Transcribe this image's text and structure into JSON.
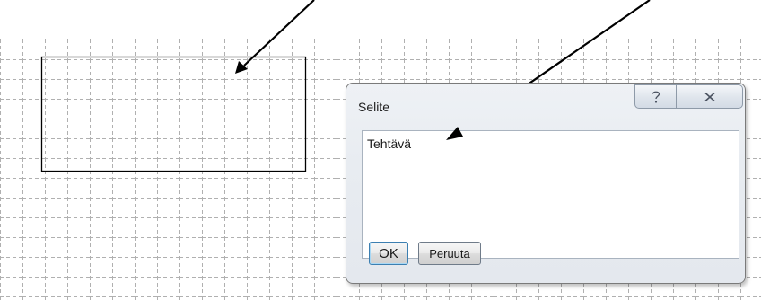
{
  "dialog": {
    "title": "Selite",
    "help_icon": "question-mark-icon",
    "close_icon": "close-x-icon",
    "text_value": "Tehtävä",
    "ok_label": "OK",
    "cancel_label": "Peruuta"
  },
  "canvas": {
    "shape": "rectangle",
    "grid": true
  },
  "annotations": {
    "arrow_count": 2
  },
  "colors": {
    "grid": "#b8b8b8",
    "rect_border": "#000000",
    "dialog_bg": "#e8ecf1",
    "ok_focus": "#3c7fb1"
  }
}
